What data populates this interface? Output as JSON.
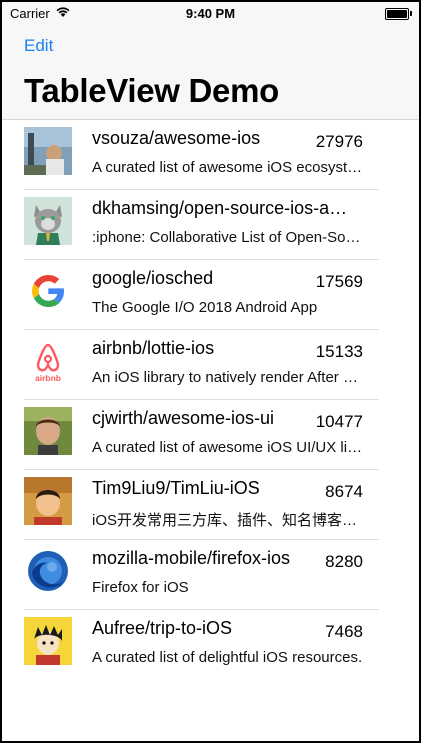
{
  "status": {
    "carrier": "Carrier",
    "time": "9:40 PM"
  },
  "nav": {
    "edit_label": "Edit",
    "title": "TableView Demo"
  },
  "rows": [
    {
      "name": "vsouza/awesome-ios",
      "stars": "27976",
      "desc": "A curated list of awesome iOS ecosystem, including Objective-C and Swift Projects"
    },
    {
      "name": "dkhamsing/open-source-ios-apps",
      "stars": "",
      "desc": ":iphone: Collaborative List of Open-Source iOS Apps"
    },
    {
      "name": "google/iosched",
      "stars": "17569",
      "desc": "The Google I/O 2018 Android App"
    },
    {
      "name": "airbnb/lottie-ios",
      "stars": "15133",
      "desc": "An iOS library to natively render After Effects vector animations"
    },
    {
      "name": "cjwirth/awesome-ios-ui",
      "stars": "10477",
      "desc": "A curated list of awesome iOS UI/UX libraries"
    },
    {
      "name": "Tim9Liu9/TimLiu-iOS",
      "stars": "8674",
      "desc": "iOS开发常用三方库、插件、知名博客等等"
    },
    {
      "name": "mozilla-mobile/firefox-ios",
      "stars": "8280",
      "desc": "Firefox for iOS"
    },
    {
      "name": "Aufree/trip-to-iOS",
      "stars": "7468",
      "desc": "A curated list of delightful iOS resources."
    }
  ],
  "avatars": [
    "photo-avatar",
    "cat-avatar",
    "google-logo-icon",
    "airbnb-logo-icon",
    "photo-avatar",
    "photo-avatar",
    "firefox-logo-icon",
    "cartoon-avatar"
  ],
  "colors": {
    "accent": "#1a82ef",
    "nav_bg": "#f7f7f7"
  }
}
